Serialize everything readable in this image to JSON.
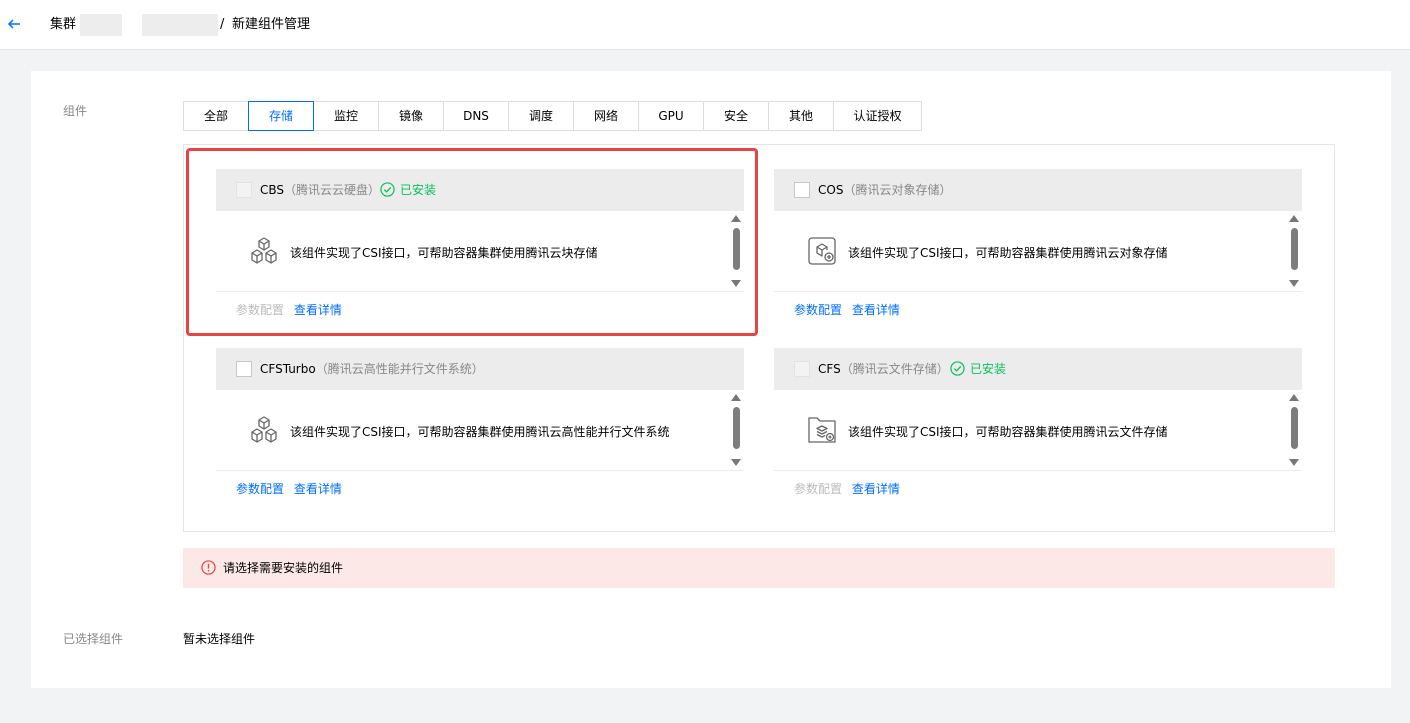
{
  "breadcrumb": {
    "parent": "集群",
    "separator": "/",
    "current": "新建组件管理"
  },
  "form": {
    "components_label": "组件",
    "selected_label": "已选择组件",
    "selected_value": "暂未选择组件"
  },
  "tabs": [
    {
      "label": "全部",
      "active": false
    },
    {
      "label": "存储",
      "active": true
    },
    {
      "label": "监控",
      "active": false
    },
    {
      "label": "镜像",
      "active": false
    },
    {
      "label": "DNS",
      "active": false
    },
    {
      "label": "调度",
      "active": false
    },
    {
      "label": "网络",
      "active": false
    },
    {
      "label": "GPU",
      "active": false
    },
    {
      "label": "安全",
      "active": false
    },
    {
      "label": "其他",
      "active": false
    },
    {
      "label": "认证授权",
      "active": false
    }
  ],
  "cards": [
    {
      "name": "CBS",
      "subtitle": "（腾讯云云硬盘）",
      "installed": true,
      "installed_label": "已安装",
      "icon": "cube-outline-icon",
      "description": "该组件实现了CSI接口，可帮助容器集群使用腾讯云块存储",
      "param_label": "参数配置",
      "param_enabled": false,
      "detail_label": "查看详情"
    },
    {
      "name": "COS",
      "subtitle": "（腾讯云对象存储）",
      "installed": false,
      "installed_label": "",
      "icon": "object-storage-icon",
      "description": "该组件实现了CSI接口，可帮助容器集群使用腾讯云对象存储",
      "param_label": "参数配置",
      "param_enabled": true,
      "detail_label": "查看详情"
    },
    {
      "name": "CFSTurbo",
      "subtitle": "（腾讯云高性能并行文件系统）",
      "installed": false,
      "installed_label": "",
      "icon": "cube-outline-icon",
      "description": "该组件实现了CSI接口，可帮助容器集群使用腾讯云高性能并行文件系统",
      "param_label": "参数配置",
      "param_enabled": true,
      "detail_label": "查看详情"
    },
    {
      "name": "CFS",
      "subtitle": "（腾讯云文件存储）",
      "installed": true,
      "installed_label": "已安装",
      "icon": "file-storage-icon",
      "description": "该组件实现了CSI接口，可帮助容器集群使用腾讯云文件存储",
      "param_label": "参数配置",
      "param_enabled": false,
      "detail_label": "查看详情"
    }
  ],
  "alert": {
    "message": "请选择需要安装的组件"
  },
  "colors": {
    "accent": "#006eff",
    "success": "#0abf5b",
    "error": "#e54545",
    "alert_bg": "#fde8e8"
  }
}
